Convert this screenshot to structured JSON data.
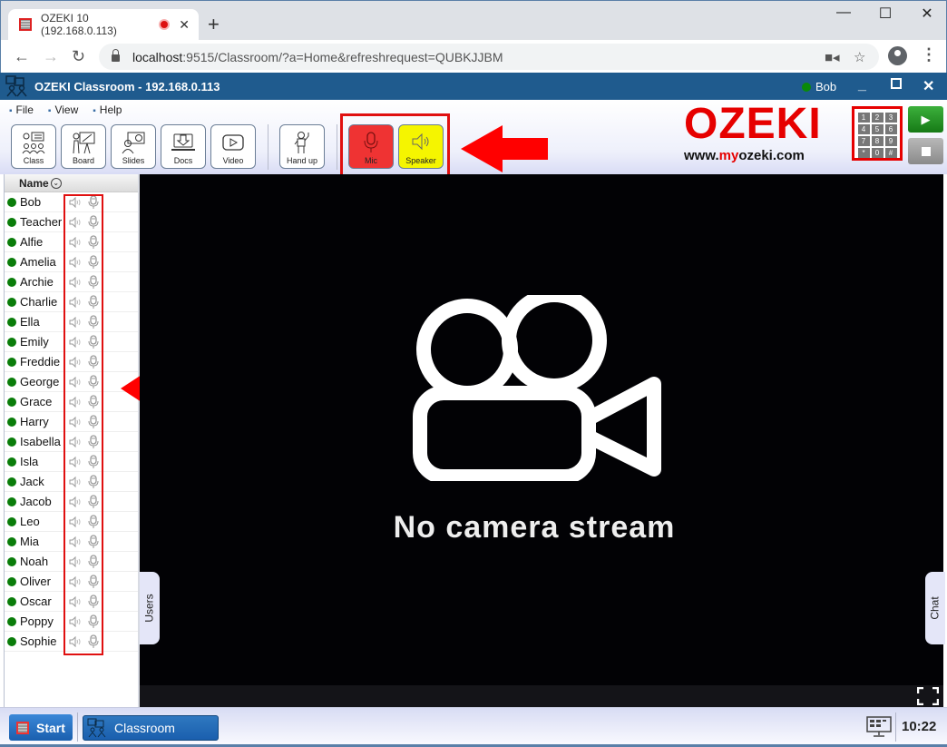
{
  "browser": {
    "tab_title": "OZEKI 10 (192.168.0.113)",
    "new_tab_label": "+",
    "url_host": "localhost",
    "url_rest": ":9515/Classroom/?a=Home&refreshrequest=QUBKJJBM",
    "window_controls": {
      "minimize": "—",
      "maximize": "☐",
      "close": "✕"
    }
  },
  "app": {
    "title": "OZEKI Classroom - 192.168.0.113",
    "current_user": "Bob",
    "status_color": "#0a8a0a",
    "header_color": "#1f5b8e"
  },
  "menu": [
    "File",
    "View",
    "Help"
  ],
  "toolbar": {
    "buttons": [
      {
        "label": "Class",
        "icon": "class-icon"
      },
      {
        "label": "Board",
        "icon": "board-icon"
      },
      {
        "label": "Slides",
        "icon": "slides-icon"
      },
      {
        "label": "Docs",
        "icon": "docs-icon"
      },
      {
        "label": "Video",
        "icon": "video-icon"
      },
      {
        "label": "Hand up",
        "icon": "hand-up-icon"
      },
      {
        "label": "Mic",
        "icon": "microphone-icon",
        "color": "#ef3333"
      },
      {
        "label": "Speaker",
        "icon": "speaker-icon",
        "color": "#f5f500"
      }
    ]
  },
  "brand": {
    "logo_text": "OZEKI",
    "url_prefix": "www.",
    "url_my": "my",
    "url_suffix": "ozeki.com",
    "keypad": [
      "1",
      "2",
      "3",
      "4",
      "5",
      "6",
      "7",
      "8",
      "9",
      "*",
      "0",
      "#"
    ],
    "accent_color": "#e60000"
  },
  "user_list": {
    "header": "Name",
    "users": [
      "Bob",
      "Teacher",
      "Alfie",
      "Amelia",
      "Archie",
      "Charlie",
      "Ella",
      "Emily",
      "Freddie",
      "George",
      "Grace",
      "Harry",
      "Isabella",
      "Isla",
      "Jack",
      "Jacob",
      "Leo",
      "Mia",
      "Noah",
      "Oliver",
      "Oscar",
      "Poppy",
      "Sophie"
    ]
  },
  "video": {
    "message": "No camera stream"
  },
  "side_tabs": {
    "users": "Users",
    "chat": "Chat"
  },
  "taskbar": {
    "start_label": "Start",
    "task_label": "Classroom",
    "clock": "10:22"
  }
}
